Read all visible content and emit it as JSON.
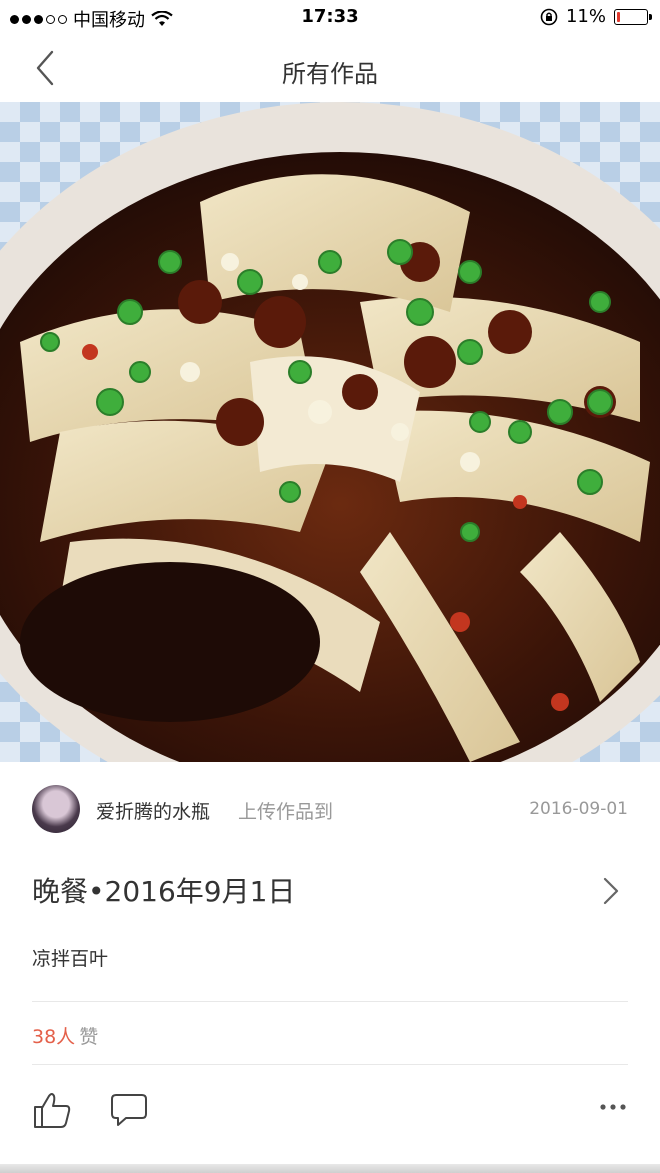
{
  "status_bar": {
    "carrier": "中国移动",
    "time": "17:33",
    "battery": "11%",
    "battery_level": 0.11
  },
  "nav": {
    "title": "所有作品",
    "back_icon": "chevron-left-icon"
  },
  "post": {
    "image_icon": "food-photo",
    "author": "爱折腾的水瓶",
    "action_text": "上传作品到",
    "date": "2016-09-01",
    "title": "晚餐•2016年9月1日",
    "description": "凉拌百叶",
    "likes_count": "38人",
    "likes_label": "赞"
  },
  "colors": {
    "accent": "#e4604a",
    "muted_text": "#999999",
    "battery_low": "#e03a2f"
  }
}
